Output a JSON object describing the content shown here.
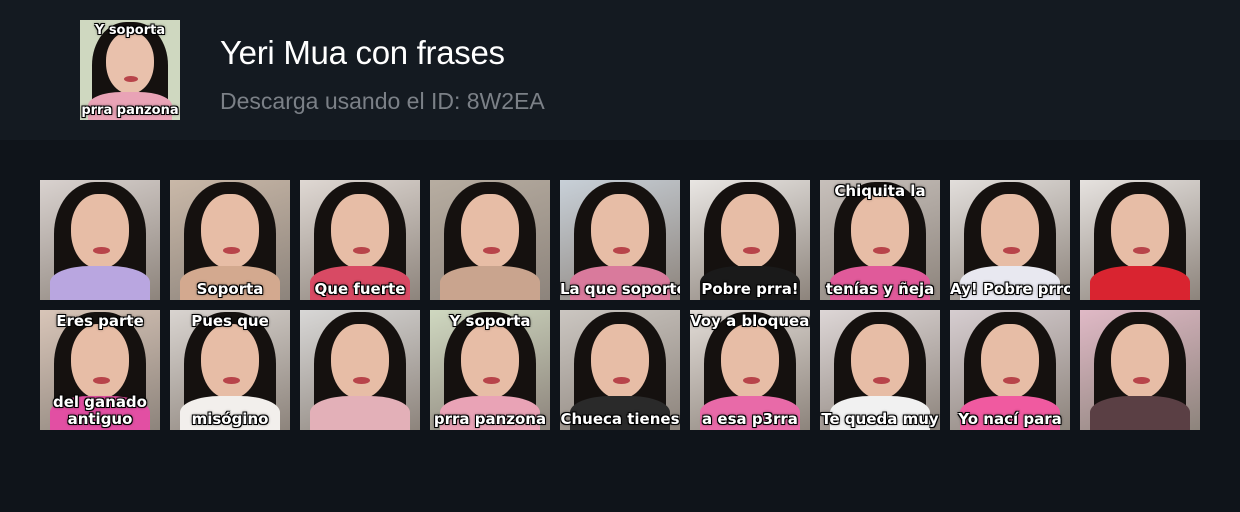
{
  "header": {
    "title": "Yeri Mua con frases",
    "subtitle": "Descarga usando el ID: 8W2EA",
    "thumbnail": {
      "top": "Y soporta",
      "bottom": "prra panzona",
      "bg": "#cfd8c0",
      "accent": "#e9a3b6"
    }
  },
  "stickers": [
    {
      "top": "",
      "bottom": "",
      "bg": "#d9d2cf",
      "outfit": "#b9a6e0"
    },
    {
      "top": "",
      "bottom": "Soporta",
      "bg": "#c9b8a8",
      "outfit": "#d3a98f"
    },
    {
      "top": "",
      "bottom": "Que fuerte",
      "bg": "#dfd8d3",
      "outfit": "#d84a64"
    },
    {
      "top": "",
      "bottom": "",
      "bg": "#b7ada1",
      "outfit": "#c9a48e"
    },
    {
      "top": "",
      "bottom": "La que soporte",
      "bg": "#c8d0d8",
      "outfit": "#d97a9c"
    },
    {
      "top": "",
      "bottom": "Pobre prra!",
      "bg": "#e9e6e3",
      "outfit": "#1a1a1a"
    },
    {
      "top": "Chiquita la",
      "bottom": "tenías y ñeja",
      "bg": "#c7c0bb",
      "outfit": "#e05a9a"
    },
    {
      "top": "",
      "bottom": "Ay! Pobre prro",
      "bg": "#e2dedb",
      "outfit": "#e8e8f0"
    },
    {
      "top": "",
      "bottom": "",
      "bg": "#e6e2df",
      "outfit": "#d92430"
    },
    {
      "top": "Eres parte",
      "bottom": "del ganado\nantiguo",
      "bg": "#d8c5b8",
      "outfit": "#e24fa3"
    },
    {
      "top": "Pues que",
      "bottom": "misógino",
      "bg": "#d9d4d0",
      "outfit": "#f2efec"
    },
    {
      "top": "",
      "bottom": "",
      "bg": "#d8d7d6",
      "outfit": "#e3b0b8"
    },
    {
      "top": "Y soporta",
      "bottom": "prra panzona",
      "bg": "#cfd8c0",
      "outfit": "#e9a3b6"
    },
    {
      "top": "",
      "bottom": "Chueca tienes",
      "bg": "#cbc6c1",
      "outfit": "#2a2a2a"
    },
    {
      "top": "Voy a bloquear",
      "bottom": "a esa p3rra",
      "bg": "#e2dcd7",
      "outfit": "#e86aa8"
    },
    {
      "top": "",
      "bottom": "Te queda muy",
      "bg": "#ddd6d6",
      "outfit": "#f1f1f1"
    },
    {
      "top": "",
      "bottom": "Yo nací para",
      "bg": "#d6cdd0",
      "outfit": "#f05aa0"
    },
    {
      "top": "",
      "bottom": "",
      "bg": "#e0b9c6",
      "outfit": "#5a3f44"
    }
  ]
}
